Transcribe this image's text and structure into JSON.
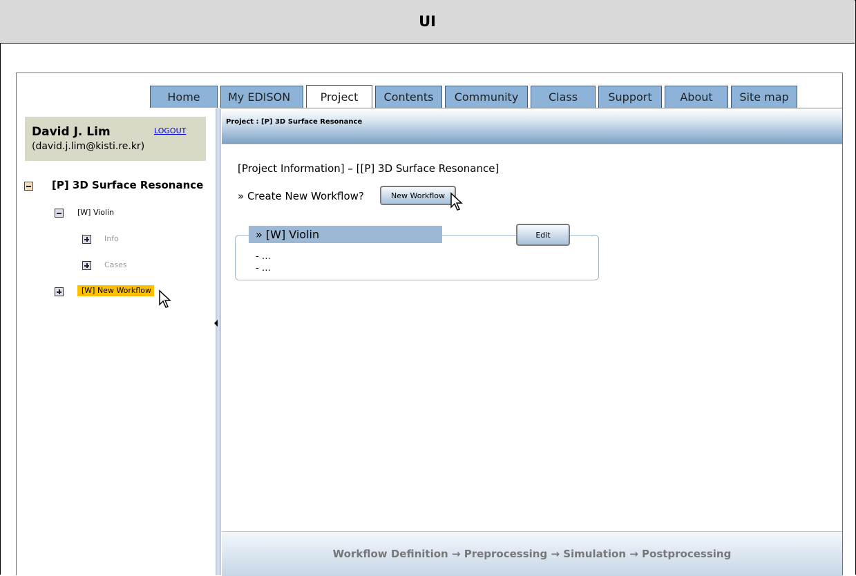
{
  "title": "UI",
  "tabs": [
    {
      "label": "Home",
      "active": false
    },
    {
      "label": "My EDISON",
      "active": false
    },
    {
      "label": "Project",
      "active": true
    },
    {
      "label": "Contents",
      "active": false
    },
    {
      "label": "Community",
      "active": false
    },
    {
      "label": "Class",
      "active": false
    },
    {
      "label": "Support",
      "active": false
    },
    {
      "label": "About",
      "active": false
    },
    {
      "label": "Site map",
      "active": false
    }
  ],
  "user": {
    "name": "David J. Lim",
    "email": "(david.j.lim@kisti.re.kr)",
    "logout": "LOGOUT"
  },
  "tree": {
    "project": "[P] 3D Surface Resonance",
    "workflow": "[W] Violin",
    "info": "Info",
    "cases": "Cases",
    "new_workflow": "[W] New Workflow"
  },
  "main": {
    "header": "Project : [P] 3D Surface Resonance",
    "project_info": "[Project Information] – [[P] 3D Surface Resonance]",
    "create_question": "» Create New Workflow?",
    "new_workflow_button": "New Workflow",
    "workflow_title": "» [W] Violin",
    "edit_button": "Edit",
    "workflow_lines": [
      "- …",
      "- …"
    ],
    "footer": "Workflow Definition → Preprocessing → Simulation → Postprocessing"
  },
  "colors": {
    "tab": "#8db3d9",
    "title_bar": "#d9d9d9",
    "highlight": "#ffc000",
    "user_box": "#d9d9c8"
  }
}
